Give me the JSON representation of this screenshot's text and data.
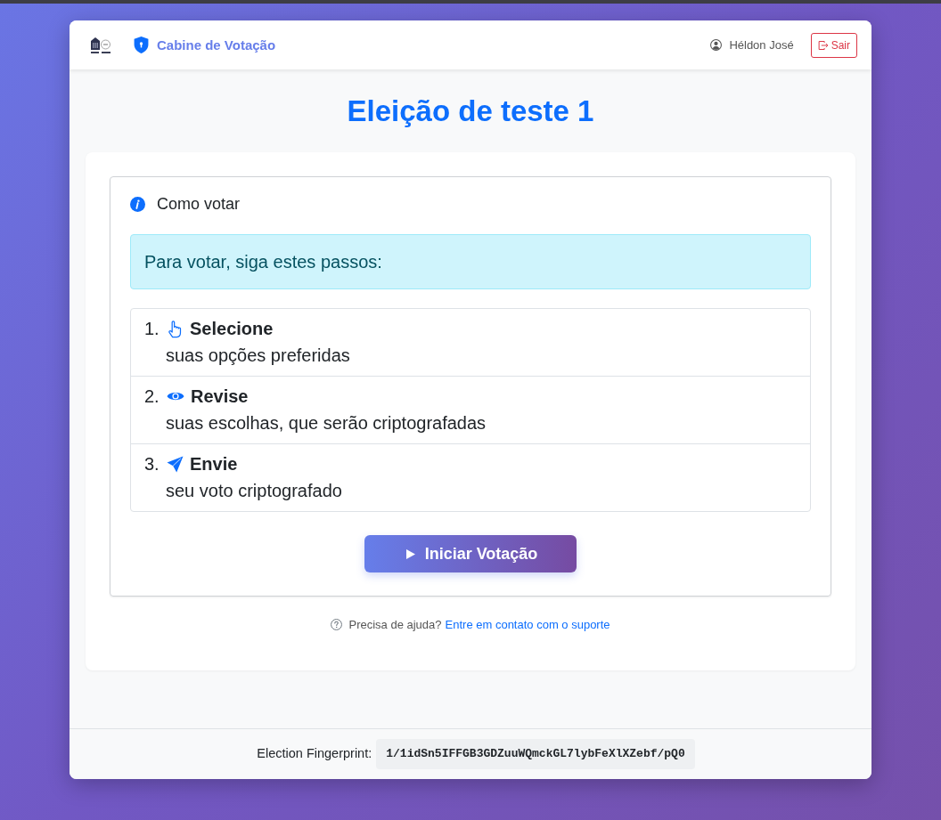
{
  "header": {
    "title": "Cabine de Votação",
    "user": "Héldon José",
    "logout": "Sair"
  },
  "election_title": "Eleição de teste 1",
  "instructions": {
    "heading": "Como votar",
    "alert": "Para votar, siga estes passos:",
    "steps": [
      {
        "kind": "hand",
        "number": "1.",
        "title": "Selecione",
        "description": "suas opções preferidas"
      },
      {
        "kind": "eye",
        "number": "2.",
        "title": "Revise",
        "description": "suas escolhas, que serão criptografadas"
      },
      {
        "kind": "send",
        "number": "3.",
        "title": "Envie",
        "description": "seu voto criptografado"
      }
    ]
  },
  "start_button": "Iniciar Votação",
  "help": {
    "text": "Precisa de ajuda?",
    "link": "Entre em contato com o suporte"
  },
  "footer": {
    "label": "Election Fingerprint:",
    "fingerprint": "1/1idSn5IFFGB3GDZuuWQmckGL7lybFeXlXZebf/pQ0"
  }
}
